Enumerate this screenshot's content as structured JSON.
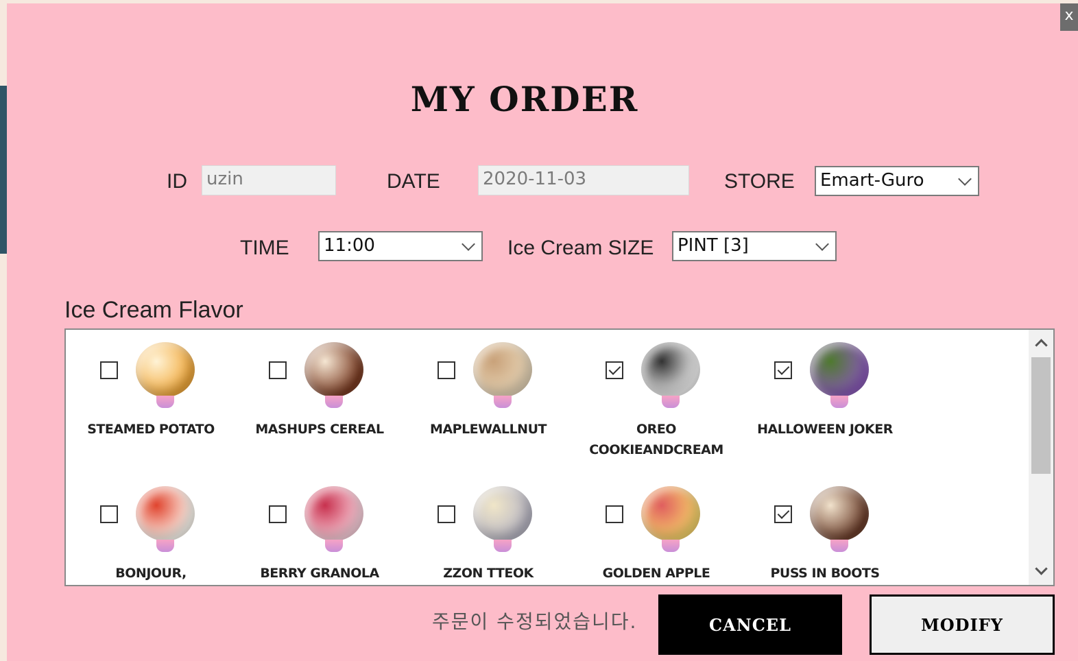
{
  "window": {
    "close_label": "x"
  },
  "title": "MY ORDER",
  "form": {
    "id_label": "ID",
    "id_value": "uzin",
    "date_label": "DATE",
    "date_value": "2020-11-03",
    "store_label": "STORE",
    "store_value": "Emart-Guro",
    "time_label": "TIME",
    "time_value": "11:00",
    "size_label": "Ice Cream SIZE",
    "size_value": "PINT [3]"
  },
  "flavors": {
    "section_label": "Ice Cream Flavor",
    "items": [
      {
        "name": "STEAMED POTATO",
        "checked": false,
        "colors": [
          "#f2a93b",
          "#fff3d6"
        ]
      },
      {
        "name": "MASHUPS CEREAL",
        "checked": false,
        "colors": [
          "#7a3b22",
          "#f5e6d3"
        ]
      },
      {
        "name": "MAPLEWALLNUT",
        "checked": false,
        "colors": [
          "#e8d6b8",
          "#c9a27a"
        ]
      },
      {
        "name": "OREO\nCOOKIEANDCREAM",
        "checked": true,
        "colors": [
          "#f4f4f4",
          "#333333"
        ]
      },
      {
        "name": "HALLOWEEN JOKER",
        "checked": true,
        "colors": [
          "#8a5bb8",
          "#4f7a2f"
        ]
      },
      {
        "name": "BONJOUR,",
        "checked": false,
        "colors": [
          "#fffaf2",
          "#e0452f"
        ]
      },
      {
        "name": "BERRY GRANOLA",
        "checked": false,
        "colors": [
          "#fbd0dc",
          "#c8324f"
        ]
      },
      {
        "name": "ZZON TTEOK",
        "checked": false,
        "colors": [
          "#b9b7c4",
          "#f0e6c8"
        ]
      },
      {
        "name": "GOLDEN APPLE",
        "checked": false,
        "colors": [
          "#f7d36a",
          "#e05f5f"
        ]
      },
      {
        "name": "PUSS IN BOOTS",
        "checked": true,
        "colors": [
          "#6b3d2a",
          "#f1e2cc"
        ]
      }
    ]
  },
  "status_message": "주문이 수정되었습니다.",
  "buttons": {
    "cancel": "CANCEL",
    "modify": "MODIFY"
  }
}
